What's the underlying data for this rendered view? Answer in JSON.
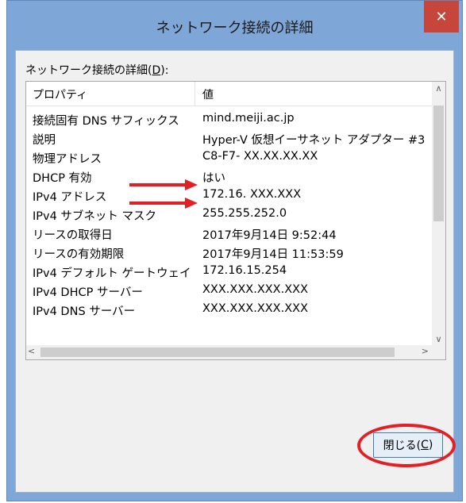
{
  "window": {
    "title": "ネットワーク接続の詳細",
    "close_glyph": "✕"
  },
  "group": {
    "label_prefix": "ネットワーク接続の詳細(",
    "label_key": "D",
    "label_suffix": "):"
  },
  "table": {
    "headers": [
      "プロパティ",
      "値"
    ],
    "rows": [
      {
        "prop": "接続固有 DNS サフィックス",
        "val": "mind.meiji.ac.jp"
      },
      {
        "prop": "説明",
        "val": "Hyper-V 仮想イーサネット アダプター #3"
      },
      {
        "prop": "物理アドレス",
        "val": "C8-F7- XX.XX.XX.XX"
      },
      {
        "prop": "DHCP 有効",
        "val": "はい"
      },
      {
        "prop": "IPv4 アドレス",
        "val": "172.16. XXX.XXX"
      },
      {
        "prop": "IPv4 サブネット マスク",
        "val": "255.255.252.0"
      },
      {
        "prop": "リースの取得日",
        "val": "2017年9月14日 9:52:44"
      },
      {
        "prop": "リースの有効期限",
        "val": "2017年9月14日 11:53:59"
      },
      {
        "prop": "IPv4 デフォルト ゲートウェイ",
        "val": "172.16.15.254"
      },
      {
        "prop": "IPv4 DHCP サーバー",
        "val": " XXX.XXX.XXX.XXX"
      },
      {
        "prop": "IPv4 DNS サーバー",
        "val": " XXX.XXX.XXX.XXX"
      }
    ]
  },
  "close_button": {
    "label_prefix": "閉じる(",
    "label_key": "C",
    "label_suffix": ")"
  },
  "annotations": {
    "color": "#e31e24"
  }
}
